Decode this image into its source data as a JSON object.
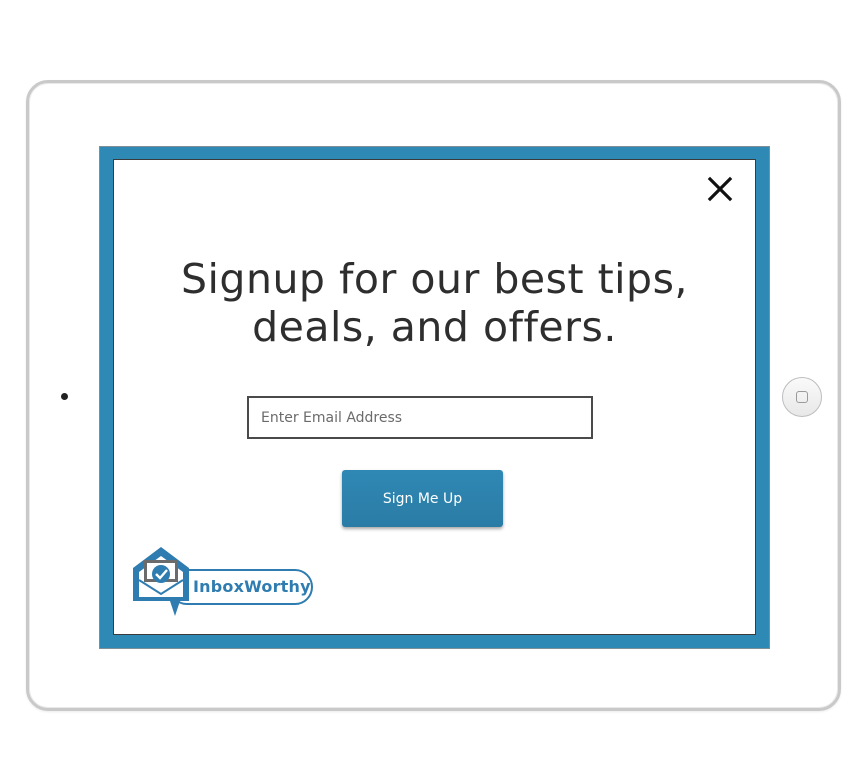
{
  "modal": {
    "headline": "Signup for our best tips, deals, and offers.",
    "email_placeholder": "Enter Email Address",
    "email_value": "",
    "submit_label": "Sign Me Up",
    "close_icon": "close-icon"
  },
  "brand": {
    "name": "InboxWorthy",
    "logo_icon": "envelope-check-icon",
    "color": "#2f7cb0"
  },
  "colors": {
    "screen_border": "#2e8ab4",
    "button": "#2f88b4"
  }
}
